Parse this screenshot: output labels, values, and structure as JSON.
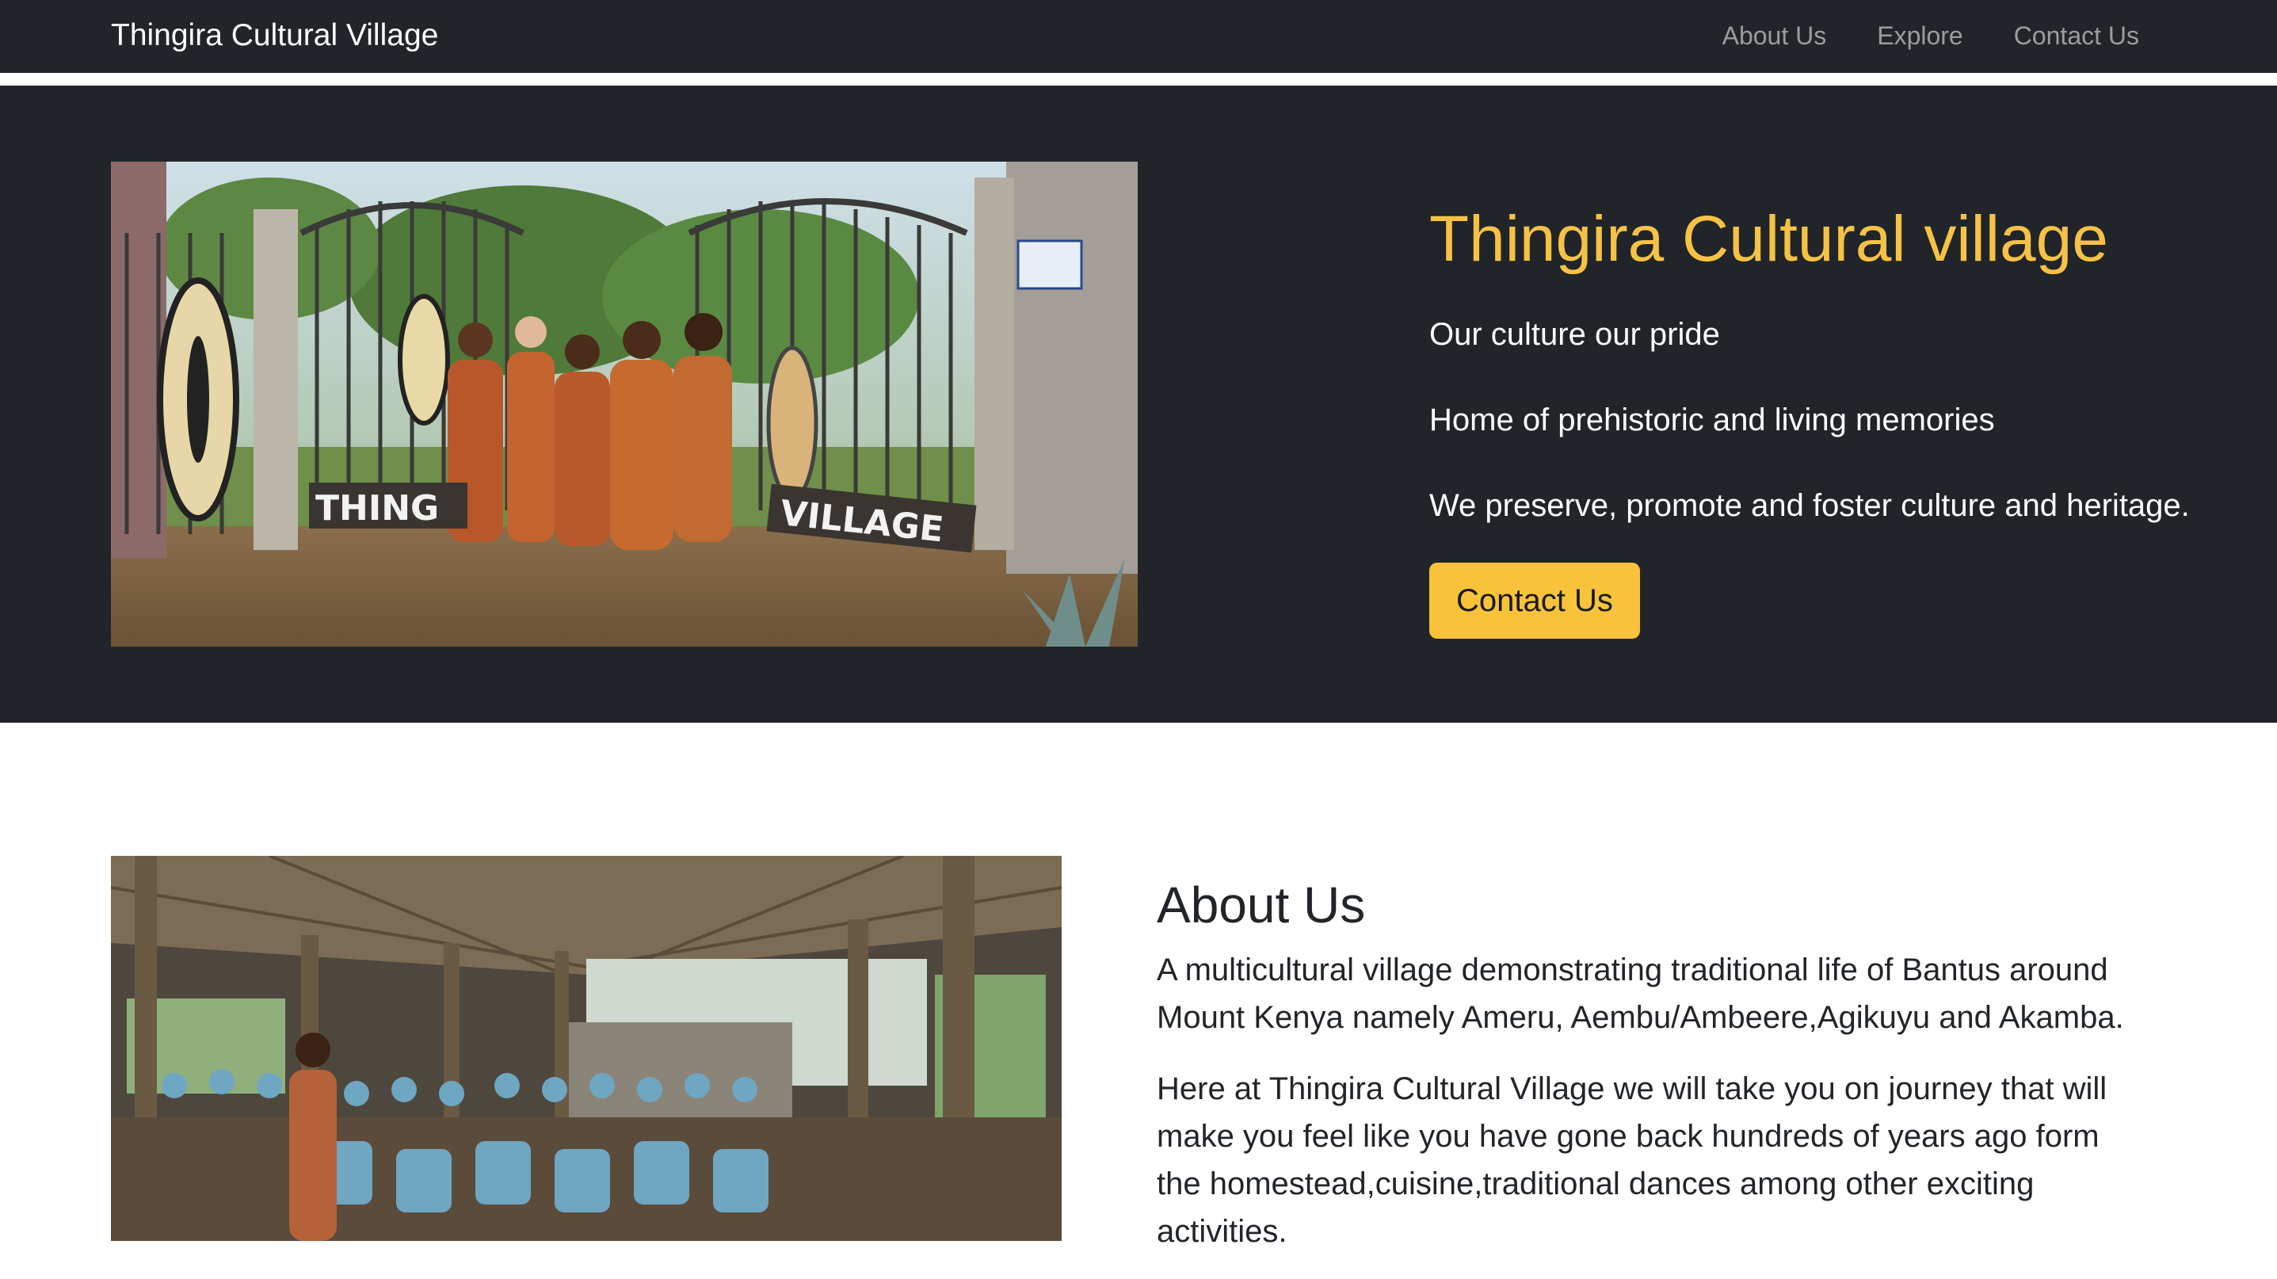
{
  "navbar": {
    "brand": "Thingira Cultural Village",
    "links": [
      "About Us",
      "Explore",
      "Contact Us"
    ]
  },
  "hero": {
    "title": "Thingira Cultural village",
    "lines": [
      "Our culture our pride",
      "Home of prehistoric and living memories",
      "We preserve, promote and foster culture and heritage."
    ],
    "button": "Contact Us",
    "image_sign_left": "THING",
    "image_sign_right": "VILLAGE"
  },
  "about": {
    "title": "About Us",
    "paragraphs": [
      "A multicultural village demonstrating traditional life of Bantus around Mount Kenya namely Ameru, Aembu/Ambeere,Agikuyu and Akamba.",
      "Here at Thingira Cultural Village we will take you on journey that will make you feel like you have gone back hundreds of years ago form the homestead,cuisine,traditional dances among other exciting activities."
    ]
  },
  "colors": {
    "navbar_bg": "#212529",
    "accent": "#f6c245",
    "button_bg": "#f8c33a"
  }
}
